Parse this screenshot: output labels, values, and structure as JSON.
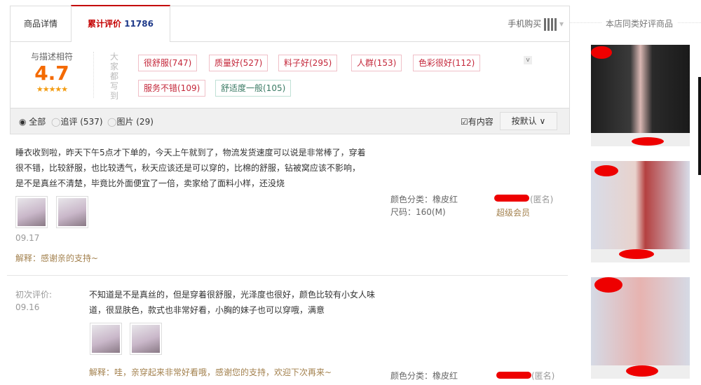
{
  "tabs": {
    "detail": "商品详情",
    "reviews_label": "累计评价",
    "reviews_count": "11786",
    "mobile_buy": "手机购买"
  },
  "rating": {
    "label": "与描述相符",
    "score": "4.7",
    "stars": 4.7,
    "everyone_says": "大家都写到",
    "tags": [
      {
        "text": "很舒服(747)"
      },
      {
        "text": "质量好(527)"
      },
      {
        "text": "料子好(295)"
      },
      {
        "text": "人群(153)"
      },
      {
        "text": "色彩很好(112)"
      },
      {
        "text": "服务不错(109)"
      },
      {
        "text": "舒适度一般(105)",
        "positive": false
      }
    ]
  },
  "filter": {
    "all": "全部",
    "append": "追评 (537)",
    "pictures": "图片 (29)",
    "has_content": "有内容",
    "sort": "按默认"
  },
  "sidebar": {
    "title": "本店同类好评商品"
  },
  "reviews": [
    {
      "text": "睡衣收到啦，昨天下午5点才下单的，今天上午就到了，物流发货速度可以说是非常棒了，穿着很不错，比较舒服，也比较透气，秋天应该还是可以穿的，比棉的舒服，钻被窝应该不影响，是不是真丝不清楚，毕竟比外面便宜了一倍，卖家给了面料小样，还没烧",
      "date": "09.17",
      "reply": "解释：感谢亲的支持~",
      "color": "颜色分类：橡皮红",
      "size": "尺码：160(M)",
      "anon": "(匿名)",
      "member": "超级会员"
    },
    {
      "first_label": "初次评价:",
      "date": "09.16",
      "text": "不知道是不是真丝的，但是穿着很舒服，光泽度也很好，颜色比较有小女人味道，很显肤色，款式也非常好看，小胸的妹子也可以穿哦，满意",
      "reply": "解释：哇，亲穿起来非常好看哦，感谢您的支持，欢迎下次再来~",
      "color": "颜色分类：橡皮红",
      "anon": "(匿名)"
    }
  ]
}
